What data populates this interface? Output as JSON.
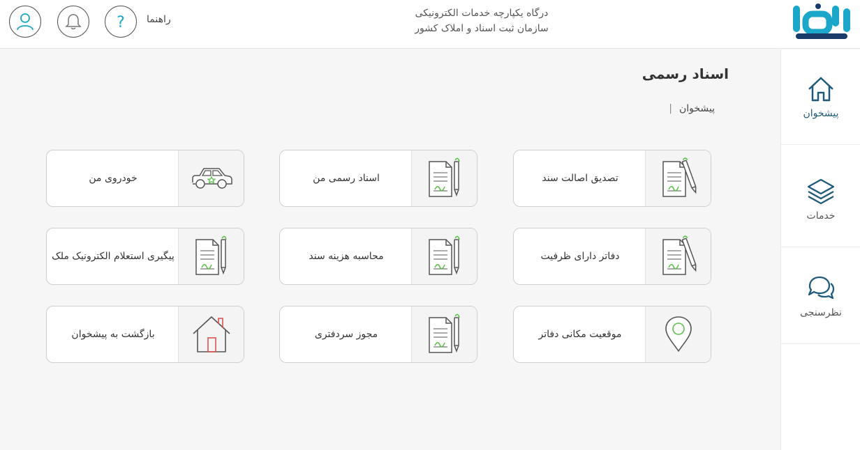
{
  "header": {
    "org_line1": "درگاه یکپارچه خدمات الکترونیکی",
    "org_line2": "سازمان ثبت اسناد و املاک کشور",
    "help_label": "راهنما",
    "icons": [
      "logo-icon",
      "help-icon",
      "bell-icon",
      "user-icon"
    ],
    "accent_color": "#1aa7c9"
  },
  "sidebar": {
    "items": [
      {
        "label": "پیشخوان",
        "icon": "home-icon",
        "active": true
      },
      {
        "label": "خدمات",
        "icon": "layers-icon",
        "active": false
      },
      {
        "label": "نظرسنجی",
        "icon": "chat-icon",
        "active": false
      }
    ],
    "active_color": "#1f5a7a"
  },
  "main": {
    "title": "اسناد رسمی",
    "breadcrumb": {
      "item": "پیشخوان",
      "separator": "|"
    },
    "cards": [
      {
        "label": "تصدیق اصالت سند",
        "icon": "signed-document-icon"
      },
      {
        "label": "اسناد رسمی من",
        "icon": "signed-document-icon"
      },
      {
        "label": "خودروی من",
        "icon": "car-icon"
      },
      {
        "label": "دفاتر دارای ظرفیت",
        "icon": "signed-document-icon"
      },
      {
        "label": "محاسبه هزینه سند",
        "icon": "signed-document-icon"
      },
      {
        "label": "پیگیری استعلام الکترونیک ملک",
        "icon": "signed-document-icon"
      },
      {
        "label": "موقعیت مکانی دفاتر",
        "icon": "location-pin-icon"
      },
      {
        "label": "مجوز سردفتری",
        "icon": "signed-document-icon"
      },
      {
        "label": "بازگشت به پیشخوان",
        "icon": "house-icon"
      }
    ],
    "icon_green": "#5cc24a"
  }
}
